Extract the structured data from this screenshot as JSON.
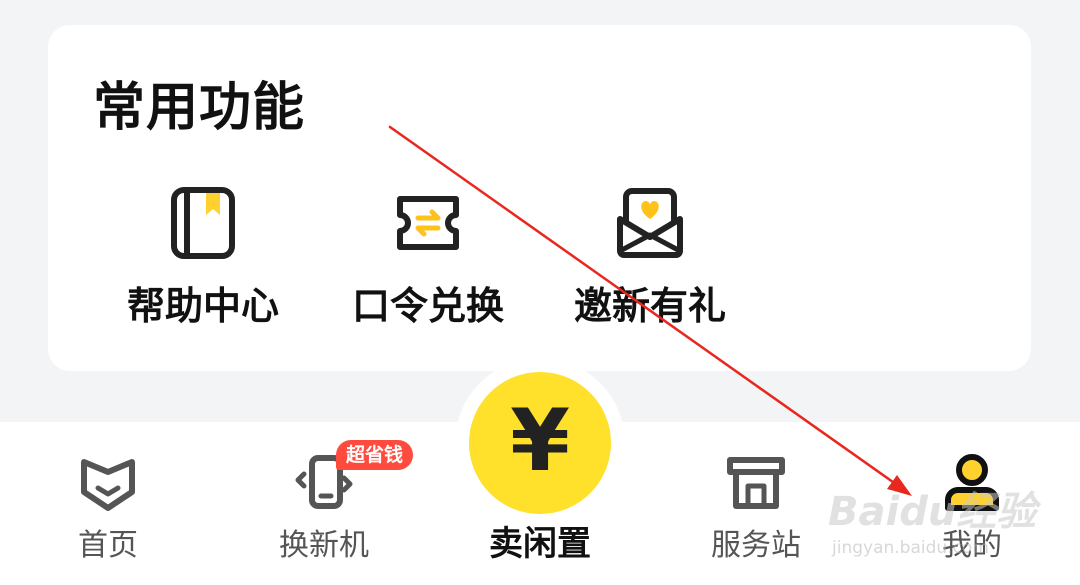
{
  "card": {
    "title": "常用功能",
    "items": [
      {
        "label": "帮助中心",
        "icon": "help-book-icon"
      },
      {
        "label": "口令兑换",
        "icon": "ticket-exchange-icon"
      },
      {
        "label": "邀新有礼",
        "icon": "invite-envelope-icon"
      }
    ]
  },
  "tabbar": {
    "items": [
      {
        "label": "首页",
        "icon": "home-icon"
      },
      {
        "label": "换新机",
        "icon": "phone-trade-in-icon",
        "badge": "超省钱"
      },
      {
        "label": "卖闲置",
        "icon": "yen-icon",
        "glyph": "¥"
      },
      {
        "label": "服务站",
        "icon": "service-station-icon"
      },
      {
        "label": "我的",
        "icon": "profile-icon"
      }
    ]
  },
  "watermark": {
    "brand": "Baidu经验",
    "url": "jingyan.baidu.com"
  },
  "colors": {
    "accent": "#ffe02b",
    "badge": "#ff4b3e",
    "arrow": "#e8281e",
    "icon_stroke": "#222222",
    "icon_fill": "#ffd12e"
  }
}
